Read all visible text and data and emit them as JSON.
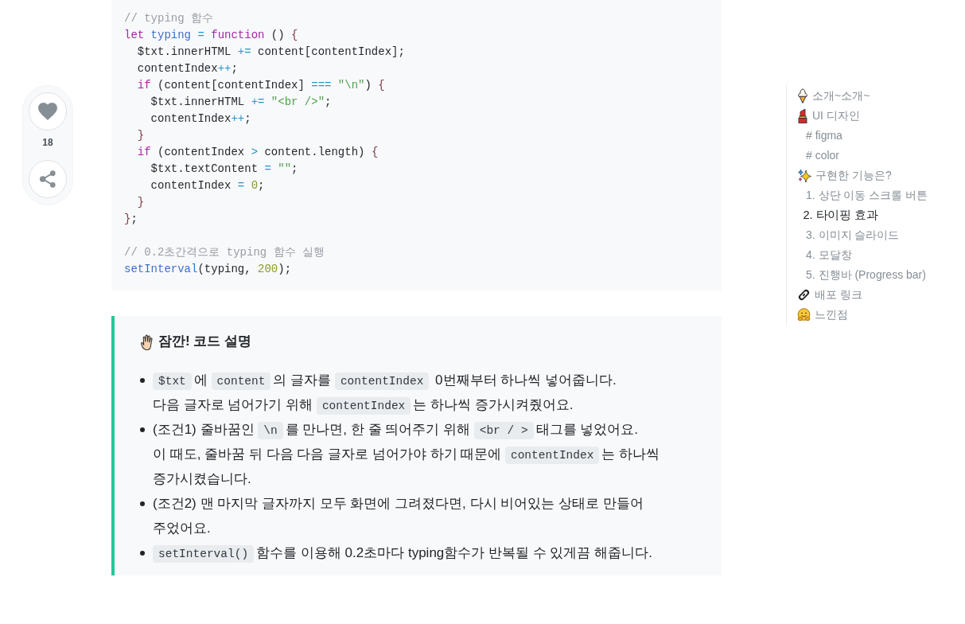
{
  "reactions": {
    "likes": "18"
  },
  "code": {
    "blocks": [
      [
        [
          {
            "kind": "comment",
            "text": "// typing 함수"
          }
        ],
        [
          {
            "kind": "keyword",
            "text": "let "
          },
          {
            "kind": "def",
            "text": "typing "
          },
          {
            "kind": "operator",
            "text": "= "
          },
          {
            "kind": "keyword",
            "text": "function"
          },
          {
            "kind": "plain",
            "text": " () "
          },
          {
            "kind": "brace",
            "text": "{"
          }
        ],
        [
          {
            "kind": "plain",
            "text": "  $txt.innerHTML "
          },
          {
            "kind": "operator",
            "text": "+="
          },
          {
            "kind": "plain",
            "text": " content[contentIndex];"
          }
        ],
        [
          {
            "kind": "plain",
            "text": "  contentIndex"
          },
          {
            "kind": "operator",
            "text": "++"
          },
          {
            "kind": "plain",
            "text": ";"
          }
        ],
        [
          {
            "kind": "keyword",
            "text": "  if"
          },
          {
            "kind": "plain",
            "text": " (content[contentIndex] "
          },
          {
            "kind": "operator",
            "text": "==="
          },
          {
            "kind": "string",
            "text": " \"\\n\""
          },
          {
            "kind": "plain",
            "text": ") "
          },
          {
            "kind": "brace",
            "text": "{"
          }
        ],
        [
          {
            "kind": "plain",
            "text": "    $txt.innerHTML "
          },
          {
            "kind": "operator",
            "text": "+="
          },
          {
            "kind": "string",
            "text": " \"<br />\""
          },
          {
            "kind": "plain",
            "text": ";"
          }
        ],
        [
          {
            "kind": "plain",
            "text": "    contentIndex"
          },
          {
            "kind": "operator",
            "text": "++"
          },
          {
            "kind": "plain",
            "text": ";"
          }
        ],
        [
          {
            "kind": "brace",
            "text": "  }"
          }
        ],
        [
          {
            "kind": "keyword",
            "text": "  if"
          },
          {
            "kind": "plain",
            "text": " (contentIndex "
          },
          {
            "kind": "operator",
            "text": ">"
          },
          {
            "kind": "plain",
            "text": " content.length) "
          },
          {
            "kind": "brace",
            "text": "{"
          }
        ],
        [
          {
            "kind": "plain",
            "text": "    $txt.textContent "
          },
          {
            "kind": "operator",
            "text": "="
          },
          {
            "kind": "string",
            "text": " \"\""
          },
          {
            "kind": "plain",
            "text": ";"
          }
        ],
        [
          {
            "kind": "plain",
            "text": "    contentIndex "
          },
          {
            "kind": "operator",
            "text": "="
          },
          {
            "kind": "number",
            "text": " 0"
          },
          {
            "kind": "plain",
            "text": ";"
          }
        ],
        [
          {
            "kind": "brace",
            "text": "  }"
          }
        ],
        [
          {
            "kind": "brace",
            "text": "}"
          },
          {
            "kind": "plain",
            "text": ";"
          }
        ]
      ],
      [
        [
          {
            "kind": "comment",
            "text": "// 0.2초간격으로 typing 함수 실행"
          }
        ],
        [
          {
            "kind": "def",
            "text": "setInterval"
          },
          {
            "kind": "plain",
            "text": "(typing, "
          },
          {
            "kind": "number",
            "text": "200"
          },
          {
            "kind": "plain",
            "text": ");"
          }
        ]
      ]
    ]
  },
  "callout": {
    "title": "잠깐! 코드 설명",
    "items": [
      {
        "lines": [
          [
            {
              "kind": "code",
              "text": "$txt"
            },
            {
              "kind": "text",
              "text": "에 "
            },
            {
              "kind": "code",
              "text": "content"
            },
            {
              "kind": "text",
              "text": "의 글자를 "
            },
            {
              "kind": "code",
              "text": "contentIndex"
            },
            {
              "kind": "text",
              "text": " 0번째부터 하나씩 넣어줍니다."
            }
          ],
          [
            {
              "kind": "text",
              "text": "다음 글자로 넘어가기 위해 "
            },
            {
              "kind": "code",
              "text": "contentIndex"
            },
            {
              "kind": "text",
              "text": "는 하나씩 증가시켜줬어요."
            }
          ]
        ]
      },
      {
        "lines": [
          [
            {
              "kind": "text",
              "text": "(조건1) 줄바꿈인 "
            },
            {
              "kind": "code",
              "text": "\\n"
            },
            {
              "kind": "text",
              "text": "를 만나면, 한 줄 띄어주기 위해 "
            },
            {
              "kind": "code",
              "text": "<br / >"
            },
            {
              "kind": "text",
              "text": "태그를 넣었어요."
            }
          ],
          [
            {
              "kind": "text",
              "text": "이 때도, 줄바꿈 뒤 다음 다음 글자로 넘어가야 하기 때문에 "
            },
            {
              "kind": "code",
              "text": "contentIndex"
            },
            {
              "kind": "text",
              "text": "는 하나씩"
            }
          ],
          [
            {
              "kind": "text",
              "text": "증가시켰습니다."
            }
          ]
        ]
      },
      {
        "lines": [
          [
            {
              "kind": "text",
              "text": "(조건2) 맨 마지막 글자까지 모두 화면에 그려졌다면, 다시 비어있는 상태로 만들어"
            }
          ],
          [
            {
              "kind": "text",
              "text": "주었어요."
            }
          ]
        ]
      },
      {
        "lines": [
          [
            {
              "kind": "code",
              "text": "setInterval()"
            },
            {
              "kind": "text",
              "text": "함수를 이용해 0.2초마다 typing함수가 반복될 수 있게끔 해줍니다."
            }
          ]
        ]
      }
    ]
  },
  "toc": {
    "items": [
      {
        "label": "소개~소개~",
        "selected": false
      },
      {
        "label": "UI 디자인",
        "selected": false,
        "children": [
          {
            "label": "# figma",
            "selected": false
          },
          {
            "label": "# color",
            "selected": false
          }
        ]
      },
      {
        "label": "구현한 기능은?",
        "selected": false,
        "children": [
          {
            "label": "1. 상단 이동 스크롤 버튼",
            "selected": false
          },
          {
            "label": "2. 타이핑 효과",
            "selected": true
          },
          {
            "label": "3. 이미지 슬라이드",
            "selected": false
          },
          {
            "label": "4. 모달창",
            "selected": false
          },
          {
            "label": "5. 진행바 (Progress bar)",
            "selected": false
          }
        ]
      },
      {
        "label": "배포 링크",
        "selected": false
      },
      {
        "label": "느낀점",
        "selected": false
      }
    ]
  }
}
